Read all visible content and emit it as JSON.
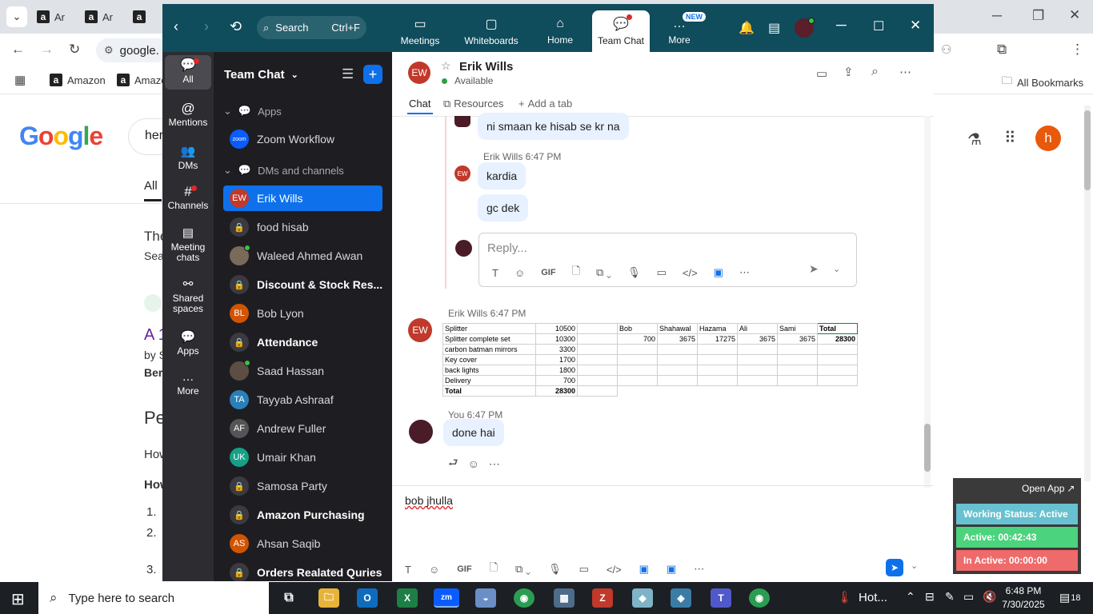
{
  "chrome": {
    "tabs": [
      {
        "label": "Ar"
      },
      {
        "label": "Ar"
      }
    ],
    "omnibox_text": "google.",
    "bookmarks": [
      {
        "label": "Amazon"
      },
      {
        "label": "Amazo"
      }
    ],
    "all_bookmarks": "All Bookmarks"
  },
  "google": {
    "logo": "Google",
    "search_snippet": "her",
    "tab_all": "All",
    "snippets": [
      "The",
      "Sea",
      "A 1",
      "by S",
      "Ber",
      "Pe",
      "How",
      "How",
      "1.",
      "2.",
      "3."
    ]
  },
  "zoom": {
    "search": {
      "label": "Search",
      "shortcut": "Ctrl+F"
    },
    "nav": [
      {
        "label": "Meetings"
      },
      {
        "label": "Whiteboards"
      },
      {
        "label": "Home"
      },
      {
        "label": "Team Chat"
      },
      {
        "label": "More",
        "badge": "NEW"
      }
    ],
    "rail": [
      {
        "label": "All"
      },
      {
        "label": "Mentions"
      },
      {
        "label": "DMs"
      },
      {
        "label": "Channels"
      },
      {
        "label": "Meeting chats"
      },
      {
        "label": "Shared spaces"
      },
      {
        "label": "Apps"
      },
      {
        "label": "More"
      }
    ],
    "list_header": "Team Chat",
    "sections": {
      "apps": "Apps",
      "dms": "DMs and channels"
    },
    "list": [
      {
        "label": "Zoom Workflow",
        "avatar": "zoom"
      },
      {
        "label": "Erik Wills",
        "avatar": "EW"
      },
      {
        "label": "food hisab",
        "avatar": ""
      },
      {
        "label": "Waleed Ahmed Awan",
        "avatar": ""
      },
      {
        "label": "Discount & Stock Res...",
        "avatar": ""
      },
      {
        "label": "Bob Lyon",
        "avatar": "BL"
      },
      {
        "label": "Attendance",
        "avatar": ""
      },
      {
        "label": "Saad Hassan",
        "avatar": ""
      },
      {
        "label": "Tayyab Ashraaf",
        "avatar": "TA"
      },
      {
        "label": "Andrew Fuller",
        "avatar": "AF"
      },
      {
        "label": "Umair Khan",
        "avatar": "UK"
      },
      {
        "label": "Samosa Party",
        "avatar": ""
      },
      {
        "label": "Amazon Purchasing",
        "avatar": ""
      },
      {
        "label": "Ahsan Saqib",
        "avatar": "AS"
      },
      {
        "label": "Orders Realated Quries",
        "avatar": ""
      }
    ],
    "chat": {
      "contact_initials": "EW",
      "contact_name": "Erik Wills",
      "status": "Available",
      "tabs": {
        "chat": "Chat",
        "resources": "Resources",
        "add": "Add a tab"
      },
      "msg_top": "ni smaan ke hisab se kr na",
      "thread_meta": "Erik Wills 6:47 PM",
      "thread_msg1": "kardia",
      "thread_msg2": "gc dek",
      "reply_placeholder": "Reply...",
      "gif": "GIF",
      "image_meta": "Erik Wills 6:47 PM",
      "you_meta": "You 6:47 PM",
      "you_msg": "done hai",
      "compose_text": "bob jhulla "
    },
    "sheet": {
      "left": [
        [
          "Splitter",
          "10500"
        ],
        [
          "Splitter complete set",
          "10300"
        ],
        [
          "carbon batman mirrors",
          "3300"
        ],
        [
          "Key cover",
          "1700"
        ],
        [
          "back lights",
          "1800"
        ],
        [
          "Delivery",
          "700"
        ],
        [
          "Total",
          "28300"
        ]
      ],
      "right_headers": [
        "Bob",
        "Shahawal",
        "Hazama",
        "Ali",
        "Sami",
        "Total"
      ],
      "right_values": [
        "700",
        "3675",
        "17275",
        "3675",
        "3675",
        "28300"
      ]
    }
  },
  "widget": {
    "open_app": "Open App",
    "working_status": "Working Status: Active",
    "active": "Active: 00:42:43",
    "inactive": "In Active: 00:00:00"
  },
  "taskbar": {
    "search_placeholder": "Type here to search",
    "weather": "Hot...",
    "time": "6:48 PM",
    "date": "7/30/2025",
    "notifications": "18"
  }
}
